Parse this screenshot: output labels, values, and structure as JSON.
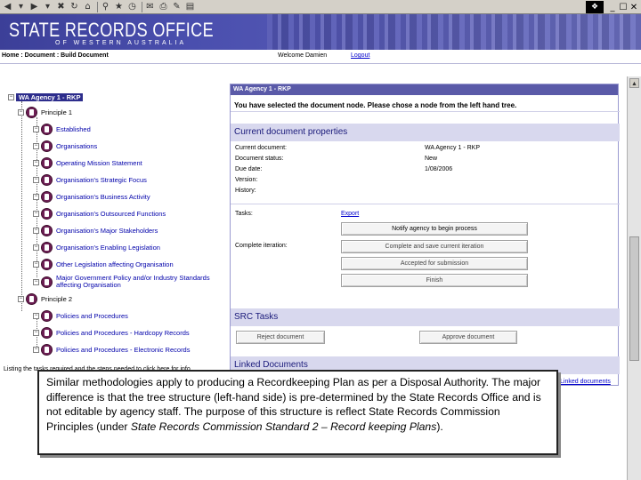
{
  "browser": {
    "toolbar_icons": [
      "back-icon",
      "forward-icon",
      "stop-icon",
      "refresh-icon",
      "home-icon",
      "search-icon",
      "favorites-icon",
      "history-icon",
      "mail-icon",
      "print-icon",
      "edit-icon",
      "discuss-icon"
    ],
    "window_controls": [
      "_",
      "☐",
      "✕"
    ]
  },
  "banner": {
    "title": "STATE RECORDS OFFICE",
    "subtitle": "OF WESTERN AUSTRALIA"
  },
  "breadcrumb": {
    "path": "Home : Document : Build Document",
    "welcome": "Welcome Damien",
    "logout": "Logout"
  },
  "tree": {
    "root": "WA Agency 1 - RKP",
    "principle1": "Principle 1",
    "items": [
      "Established",
      "Organisations",
      "Operating Mission Statement",
      "Organisation's Strategic Focus",
      "Organisation's Business Activity",
      "Organisation's Outsourced Functions",
      "Organisation's Major Stakeholders",
      "Organisation's Enabling Legislation",
      "Other Legislation affecting Organisation",
      "Major Government Policy and/or Industry Standards affecting Organisation"
    ],
    "principle2": "Principle 2",
    "principle2_items": [
      "Policies and Procedures",
      "Policies and Procedures - Hardcopy Records",
      "Policies and Procedures - Electronic Records"
    ],
    "footer": "Listing the tasks required and the steps needed to click here for info..."
  },
  "panel": {
    "title": "WA Agency 1 - RKP",
    "notice": "You have selected the document node. Please chose a node from the left hand tree.",
    "properties_heading": "Current document properties",
    "properties": [
      {
        "key": "Current document:",
        "value": "WA Agency 1 - RKP"
      },
      {
        "key": "Document status:",
        "value": "New"
      },
      {
        "key": "Due date:",
        "value": "1/08/2006"
      },
      {
        "key": "Version:",
        "value": ""
      },
      {
        "key": "History:",
        "value": ""
      }
    ],
    "tasks_label": "Tasks:",
    "export_link": "Export",
    "notify_button": "Notify agency to begin process",
    "complete_label": "Complete iteration:",
    "complete_button": "Complete and save current iteration",
    "accepted_button": "Accepted for submission",
    "finish_button": "Finish",
    "src_heading": "SRC Tasks",
    "reject_button": "Reject document",
    "approve_button": "Approve document",
    "linked_heading": "Linked Documents",
    "linked_link": "Linked documents"
  },
  "caption": {
    "part1": "Similar methodologies apply to producing a Recordkeeping Plan as per a Disposal Authority. The major difference is that the tree structure (left-hand side) is pre-determined by the State Records Office and is not editable by agency staff. The purpose of this structure is reflect State Records Commission Principles (under ",
    "emphasis": "State Records Commission Standard 2 – Record keeping Plans",
    "part2": ")."
  },
  "colors": {
    "banner": "#4a4fae",
    "panel_header": "#5a5aa8",
    "section_bg": "#d8d8ee",
    "tree_icon": "#6e1f55",
    "link": "#0000cc"
  }
}
